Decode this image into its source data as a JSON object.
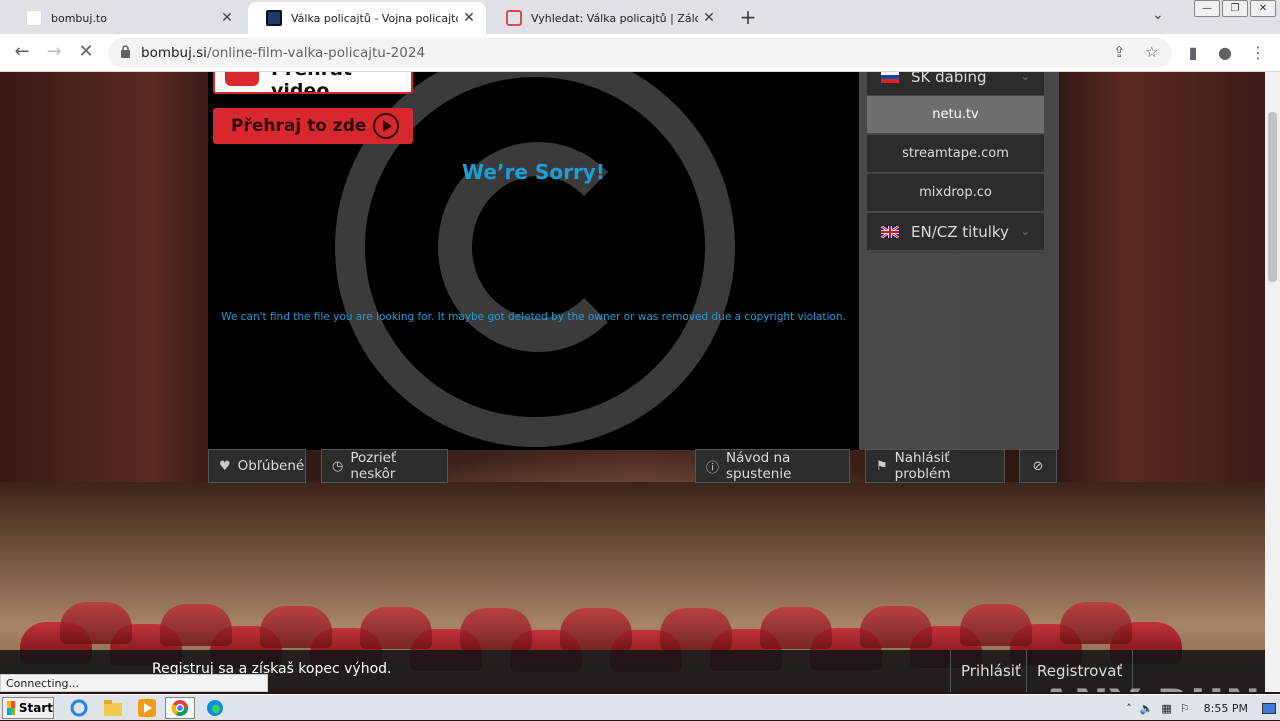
{
  "browser": {
    "tabs": [
      {
        "title": "bombuj.to",
        "close": "✕"
      },
      {
        "title": "Válka policajtů - Vojna policajtov online",
        "close": "✕"
      },
      {
        "title": "Vyhledat: Válka policajtů | Zálohuj.si",
        "close": "✕"
      }
    ],
    "url_host": "bombuj.si",
    "url_path": "/online-film-valka-policajtu-2024",
    "status": "Connecting..."
  },
  "page": {
    "play_video_label": "Přehrát video",
    "play_here_label": "Přehraj to zde",
    "sorry_title": "We’re Sorry!",
    "sorry_message": "We can't find the file you are looking for. It maybe got deleted by the owner or was removed due a copyright violation.",
    "sources": {
      "sk_dubbing": "SK dabing",
      "items": [
        "netu.tv",
        "streamtape.com",
        "mixdrop.co"
      ],
      "en_cz": "EN/CZ titulky"
    },
    "actions": {
      "favorite": "Obľúbené",
      "watch_later": "Pozrieť neskôr",
      "guide": "Návod na spustenie",
      "report": "Nahlásiť problém"
    },
    "login_bar": {
      "promo": "Registruj sa a získaš kopec výhod.",
      "login": "Prihlásiť",
      "register": "Registrovať"
    }
  },
  "watermark": "ANY RUN",
  "taskbar": {
    "start": "Start",
    "clock": "8:55 PM"
  },
  "colors": {
    "accent_red": "#d9272e",
    "sorry_blue": "#1c9ed9"
  }
}
